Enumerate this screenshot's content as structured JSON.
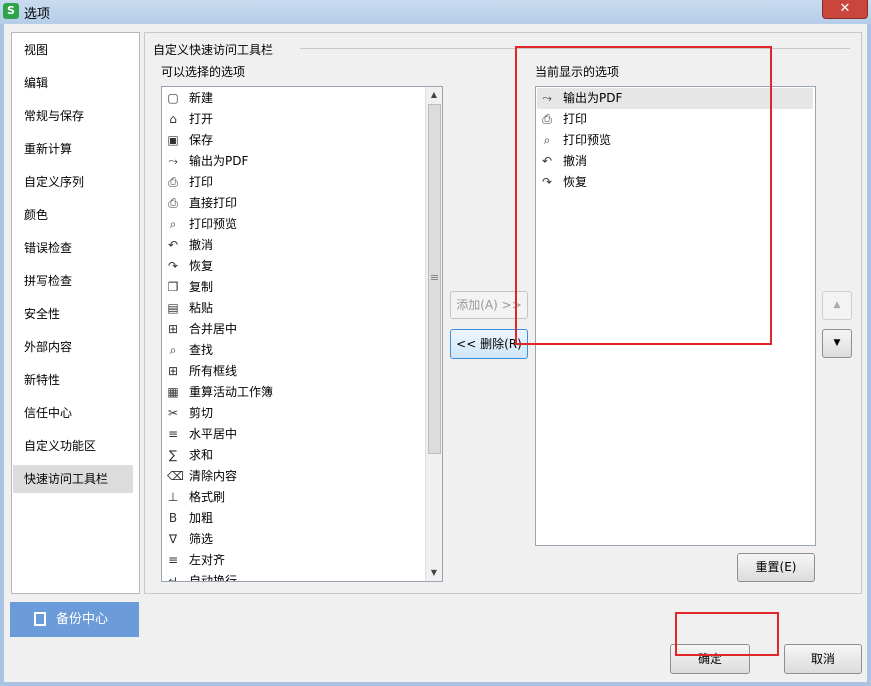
{
  "window": {
    "title": "选项",
    "app_badge": "S",
    "close_glyph": "✕"
  },
  "nav": {
    "items": [
      "视图",
      "编辑",
      "常规与保存",
      "重新计算",
      "自定义序列",
      "颜色",
      "错误检查",
      "拼写检查",
      "安全性",
      "外部内容",
      "新特性",
      "信任中心",
      "自定义功能区",
      "快速访问工具栏"
    ],
    "selected": "快速访问工具栏"
  },
  "backup": {
    "label": "备份中心",
    "icon": "backup-icon"
  },
  "panel": {
    "group_title": "自定义快速访问工具栏",
    "left_label": "可以选择的选项",
    "right_label": "当前显示的选项",
    "available": [
      {
        "icon": "▢",
        "name": "new-doc-icon",
        "label": "新建"
      },
      {
        "icon": "⌂",
        "name": "folder-open-icon",
        "label": "打开"
      },
      {
        "icon": "▣",
        "name": "save-icon",
        "label": "保存"
      },
      {
        "icon": "⤳",
        "name": "export-pdf-icon",
        "label": "输出为PDF"
      },
      {
        "icon": "⎙",
        "name": "print-icon",
        "label": "打印"
      },
      {
        "icon": "⎙",
        "name": "direct-print-icon",
        "label": "直接打印"
      },
      {
        "icon": "⌕",
        "name": "print-preview-icon",
        "label": "打印预览"
      },
      {
        "icon": "↶",
        "name": "undo-icon",
        "label": "撤消"
      },
      {
        "icon": "↷",
        "name": "redo-icon",
        "label": "恢复"
      },
      {
        "icon": "❐",
        "name": "copy-icon",
        "label": "复制"
      },
      {
        "icon": "▤",
        "name": "paste-icon",
        "label": "粘贴"
      },
      {
        "icon": "⊞",
        "name": "merge-center-icon",
        "label": "合并居中"
      },
      {
        "icon": "⌕",
        "name": "find-icon",
        "label": "查找"
      },
      {
        "icon": "⊞",
        "name": "all-borders-icon",
        "label": "所有框线"
      },
      {
        "icon": "▦",
        "name": "recalc-sheet-icon",
        "label": "重算活动工作簿"
      },
      {
        "icon": "✂",
        "name": "cut-icon",
        "label": "剪切"
      },
      {
        "icon": "≡",
        "name": "align-center-icon",
        "label": "水平居中"
      },
      {
        "icon": "∑",
        "name": "sum-icon",
        "label": "求和"
      },
      {
        "icon": "⌫",
        "name": "clear-content-icon",
        "label": "清除内容"
      },
      {
        "icon": "⊥",
        "name": "format-painter-icon",
        "label": "格式刷"
      },
      {
        "icon": "B",
        "name": "bold-icon",
        "label": "加粗"
      },
      {
        "icon": "∇",
        "name": "filter-icon",
        "label": "筛选"
      },
      {
        "icon": "≡",
        "name": "align-left-icon",
        "label": "左对齐"
      },
      {
        "icon": "↵",
        "name": "wrap-text-icon",
        "label": "自动换行"
      }
    ],
    "current": [
      {
        "icon": "⤳",
        "name": "export-pdf-icon",
        "label": "输出为PDF"
      },
      {
        "icon": "⎙",
        "name": "print-icon",
        "label": "打印"
      },
      {
        "icon": "⌕",
        "name": "print-preview-icon",
        "label": "打印预览"
      },
      {
        "icon": "↶",
        "name": "undo-icon",
        "label": "撤消"
      },
      {
        "icon": "↷",
        "name": "redo-icon",
        "label": "恢复"
      }
    ],
    "add_button": "添加(A) >>",
    "remove_button": "<< 删除(R)",
    "reset_button": "重置(E)",
    "move_up": "▲",
    "move_down": "▼"
  },
  "footer": {
    "ok": "确定",
    "cancel": "取消"
  },
  "scroll": {
    "up": "▲",
    "down": "▼"
  }
}
